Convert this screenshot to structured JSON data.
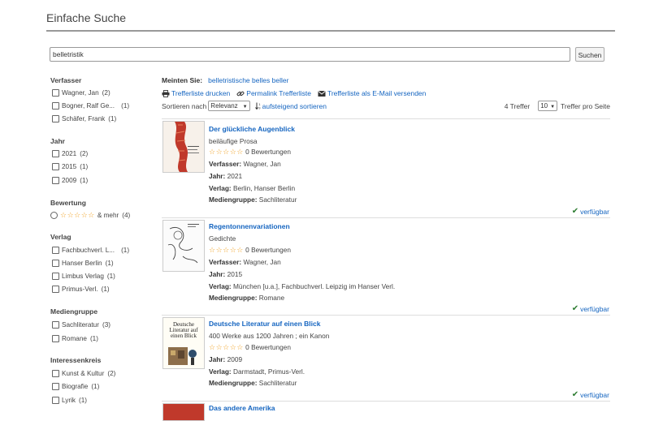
{
  "header": {
    "title": "Einfache Suche"
  },
  "search": {
    "value": "belletristik",
    "button_label": "Suchen"
  },
  "facets": [
    {
      "heading": "Verfasser",
      "items": [
        {
          "label": "Wagner, Jan",
          "count": "(2)"
        },
        {
          "label": "Bogner, Ralf Ge...",
          "count": "(1)"
        },
        {
          "label": "Schäfer, Frank",
          "count": "(1)"
        }
      ]
    },
    {
      "heading": "Jahr",
      "items": [
        {
          "label": "2021",
          "count": "(2)"
        },
        {
          "label": "2015",
          "count": "(1)"
        },
        {
          "label": "2009",
          "count": "(1)"
        }
      ]
    },
    {
      "heading": "Bewertung",
      "items": [
        {
          "label": "& mehr",
          "count": "(4)",
          "stars": "☆☆☆☆☆"
        }
      ]
    },
    {
      "heading": "Verlag",
      "items": [
        {
          "label": "Fachbuchverl. L...",
          "count": "(1)"
        },
        {
          "label": "Hanser Berlin",
          "count": "(1)"
        },
        {
          "label": "Limbus Verlag",
          "count": "(1)"
        },
        {
          "label": "Primus-Verl.",
          "count": "(1)"
        }
      ]
    },
    {
      "heading": "Mediengruppe",
      "items": [
        {
          "label": "Sachliteratur",
          "count": "(3)"
        },
        {
          "label": "Romane",
          "count": "(1)"
        }
      ]
    },
    {
      "heading": "Interessenkreis",
      "items": [
        {
          "label": "Kunst & Kultur",
          "count": "(2)"
        },
        {
          "label": "Biografie",
          "count": "(1)"
        },
        {
          "label": "Lyrik",
          "count": "(1)"
        }
      ]
    }
  ],
  "suggestion": {
    "label": "Meinten Sie:",
    "links": [
      "belletristische",
      "belles",
      "beller"
    ]
  },
  "actions": {
    "print": "Trefferliste drucken",
    "permalink": "Permalink Trefferliste",
    "email": "Trefferliste als E-Mail versenden"
  },
  "sort": {
    "label": "Sortieren nach",
    "selected": "Relevanz",
    "ascending_label": "aufsteigend sortieren",
    "hits": "4 Treffer",
    "per_page_value": "10",
    "per_page_label": "Treffer pro Seite"
  },
  "results": [
    {
      "title": "Der glückliche Augenblick",
      "subtitle": "beiläufige Prosa",
      "stars": "☆☆☆☆☆",
      "ratings": "0 Bewertungen",
      "author_label": "Verfasser:",
      "author": "Wagner, Jan",
      "year_label": "Jahr:",
      "year": "2021",
      "publisher_label": "Verlag:",
      "publisher": "Berlin, Hanser Berlin",
      "group_label": "Mediengruppe:",
      "group": "Sachliteratur",
      "availability": "verfügbar"
    },
    {
      "title": "Regentonnenvariationen",
      "subtitle": "Gedichte",
      "stars": "☆☆☆☆☆",
      "ratings": "0 Bewertungen",
      "author_label": "Verfasser:",
      "author": "Wagner, Jan",
      "year_label": "Jahr:",
      "year": "2015",
      "publisher_label": "Verlag:",
      "publisher": "München [u.a.], Fachbuchverl. Leipzig im Hanser Verl.",
      "group_label": "Mediengruppe:",
      "group": "Romane",
      "availability": "verfügbar"
    },
    {
      "title": "Deutsche Literatur auf einen Blick",
      "subtitle": "400 Werke aus 1200 Jahren ; ein Kanon",
      "stars": "☆☆☆☆☆",
      "ratings": "0 Bewertungen",
      "year_label": "Jahr:",
      "year": "2009",
      "publisher_label": "Verlag:",
      "publisher": "Darmstadt, Primus-Verl.",
      "group_label": "Mediengruppe:",
      "group": "Sachliteratur",
      "availability": "verfügbar",
      "cover_text": "Deutsche Literatur auf einen Blick"
    },
    {
      "title": "Das andere Amerika"
    }
  ]
}
